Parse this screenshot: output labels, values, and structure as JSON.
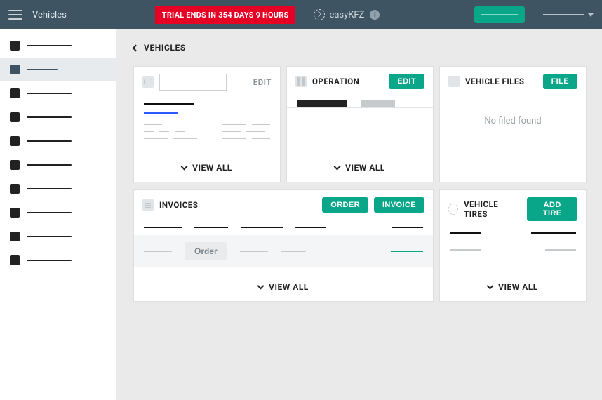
{
  "topbar": {
    "title": "Vehicles",
    "trial_text": "TRIAL ENDS IN 354 DAYS 9 HOURS",
    "brand": "easyKFZ",
    "info_glyph": "i"
  },
  "breadcrumb": {
    "label": "VEHICLES"
  },
  "cards": {
    "vehicle_detail": {
      "input_value": "",
      "edit_label": "EDIT",
      "view_all": "VIEW ALL"
    },
    "operation": {
      "title": "OPERATION",
      "edit_label": "EDIT",
      "view_all": "VIEW ALL"
    },
    "files": {
      "title": "VEHICLE FILES",
      "btn_label": "FILE",
      "empty": "No filed found"
    },
    "invoices": {
      "title": "INVOICES",
      "order_btn": "ORDER",
      "invoice_btn": "INVOICE",
      "row_order_btn": "Order",
      "view_all": "VIEW ALL"
    },
    "tires": {
      "title": "VEHICLE TIRES",
      "btn_label": "ADD TIRE",
      "view_all": "VIEW ALL"
    }
  },
  "colors": {
    "accent": "#0aa68a",
    "danger": "#e60023",
    "header": "#3e5463"
  }
}
